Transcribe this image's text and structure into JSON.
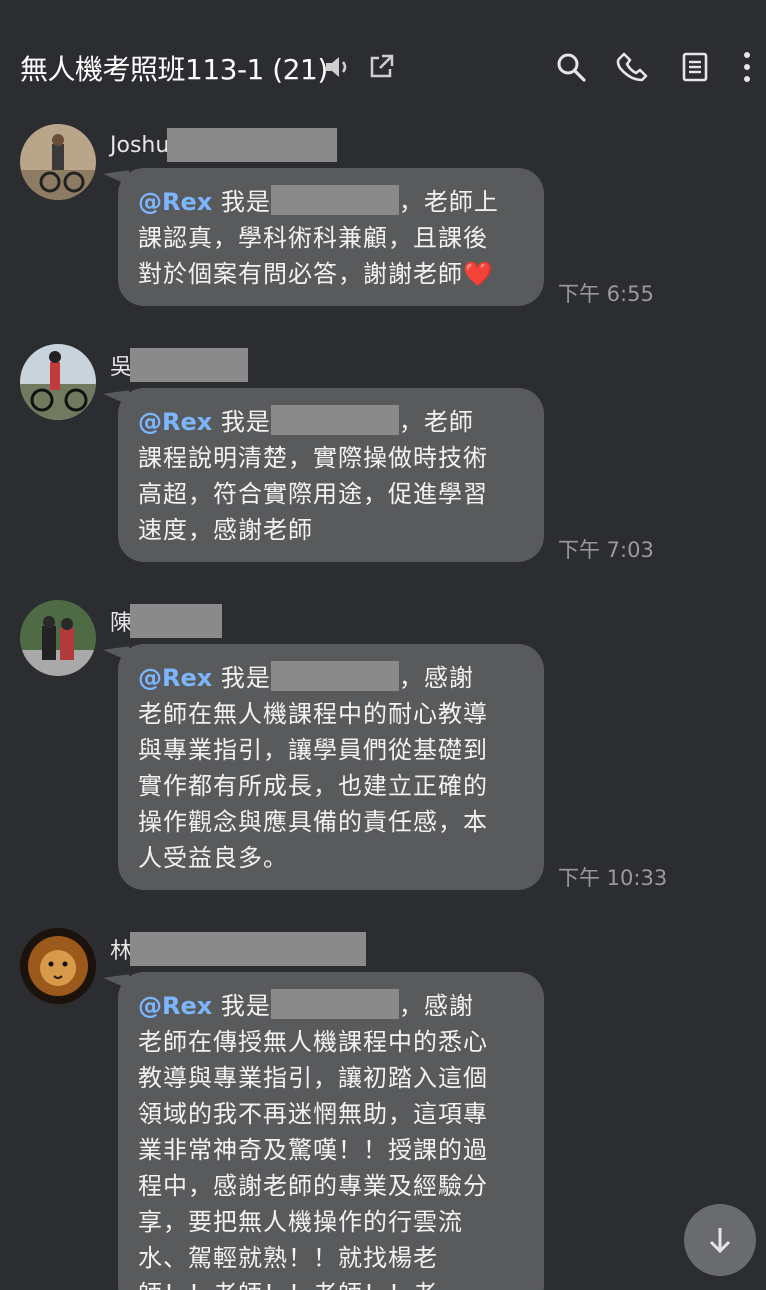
{
  "header": {
    "title": "無人機考照班113-1 (21)",
    "icons": [
      "speaker-icon",
      "open-external-icon"
    ],
    "actions": [
      "search-icon",
      "phone-icon",
      "notes-icon",
      "more-icon"
    ]
  },
  "messages": [
    {
      "sender": "Joshu",
      "mention": "@Rex",
      "lines": [
        "我是",
        "，老師上",
        "課認真，學科術科兼顧，且課後",
        "對於個案有問必答，謝謝老師",
        "❤️"
      ],
      "time": "下午 6:55"
    },
    {
      "sender": "吳",
      "mention": "@Rex",
      "lines": [
        "我是",
        "，老師",
        "課程說明清楚，實際操做時技術",
        "高超，符合實際用途，促進學習",
        "速度，感謝老師"
      ],
      "time": "下午 7:03"
    },
    {
      "sender": "陳",
      "mention": "@Rex",
      "lines": [
        "我是",
        "，感謝",
        "老師在無人機課程中的耐心教導",
        "與專業指引，讓學員們從基礎到",
        "實作都有所成長，也建立正確的",
        "操作觀念與應具備的責任感，本",
        "人受益良多。"
      ],
      "time": "下午 10:33"
    },
    {
      "sender": "林",
      "mention": "@Rex",
      "lines": [
        "我是",
        "，感謝",
        "老師在傳授無人機課程中的悉心",
        "教導與專業指引，讓初踏入這個",
        "領域的我不再迷惘無助，這項專",
        "業非常神奇及驚嘆！！授課的過",
        "程中，感謝老師的專業及經驗分",
        "享，要把無人機操作的行雲流",
        "水、駕輕就熟！！就找楊老",
        "師！！老師！！老師！！老"
      ]
    }
  ],
  "colors": {
    "background": "#2b2d31",
    "bubble": "#595a5c",
    "mention": "#7db5ff",
    "time": "#9a9a9a"
  }
}
